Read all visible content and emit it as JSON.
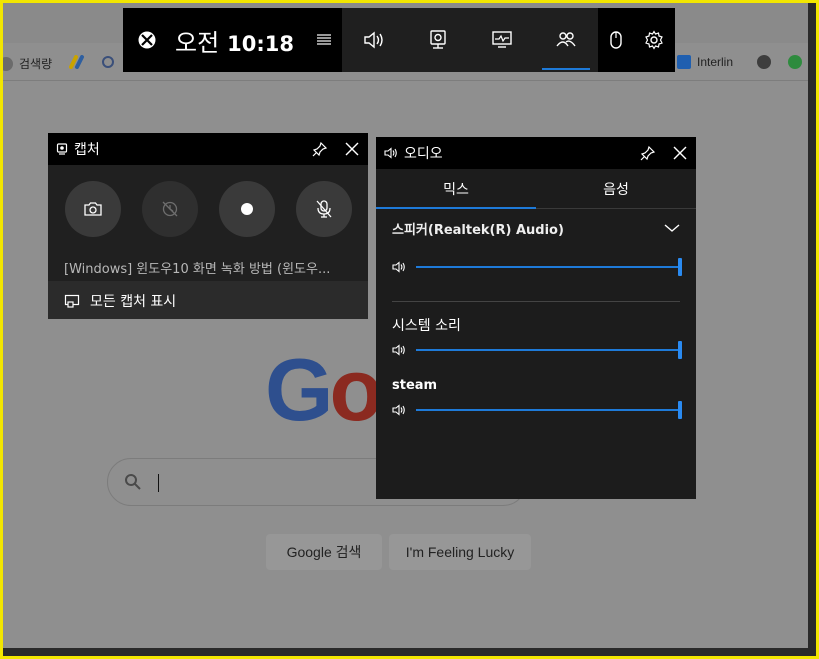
{
  "colors": {
    "accent": "#1e7ad8",
    "panel_bg": "#202020",
    "panel_header": "#000000",
    "frame": "#f2e600"
  },
  "browser": {
    "bookmarks": [
      {
        "label": "검색량",
        "icon": "globe-icon"
      },
      {
        "label": "",
        "icon": "google-ads-icon"
      },
      {
        "label": "",
        "icon": "extension-icon"
      },
      {
        "label": "Interlin",
        "icon": "bookmark-icon"
      },
      {
        "label": "",
        "icon": "globe-icon"
      },
      {
        "label": "",
        "icon": "m-icon"
      }
    ],
    "search_button": "Google 검색",
    "lucky_button": "I'm Feeling Lucky"
  },
  "gamebar": {
    "ampm": "오전",
    "clock": "10:18",
    "widgets": [
      {
        "name": "audio-widget",
        "icon": "speaker-icon"
      },
      {
        "name": "capture-widget",
        "icon": "webcam-icon"
      },
      {
        "name": "performance-widget",
        "icon": "monitor-icon"
      },
      {
        "name": "social-widget",
        "icon": "people-icon",
        "active": true
      }
    ]
  },
  "capture": {
    "title": "캡처",
    "last_capture": "[Windows] 윈도우10 화면 녹화 방법 (윈도우...",
    "show_all": "모든 캡처 표시"
  },
  "audio": {
    "title": "오디오",
    "tabs": [
      "믹스",
      "음성"
    ],
    "active_tab": 0,
    "device": "스피커(Realtek(R) Audio)",
    "master_volume": 1.0,
    "apps": [
      {
        "name": "시스템 소리",
        "volume": 1.0
      },
      {
        "name": "steam",
        "volume": 1.0
      }
    ]
  }
}
